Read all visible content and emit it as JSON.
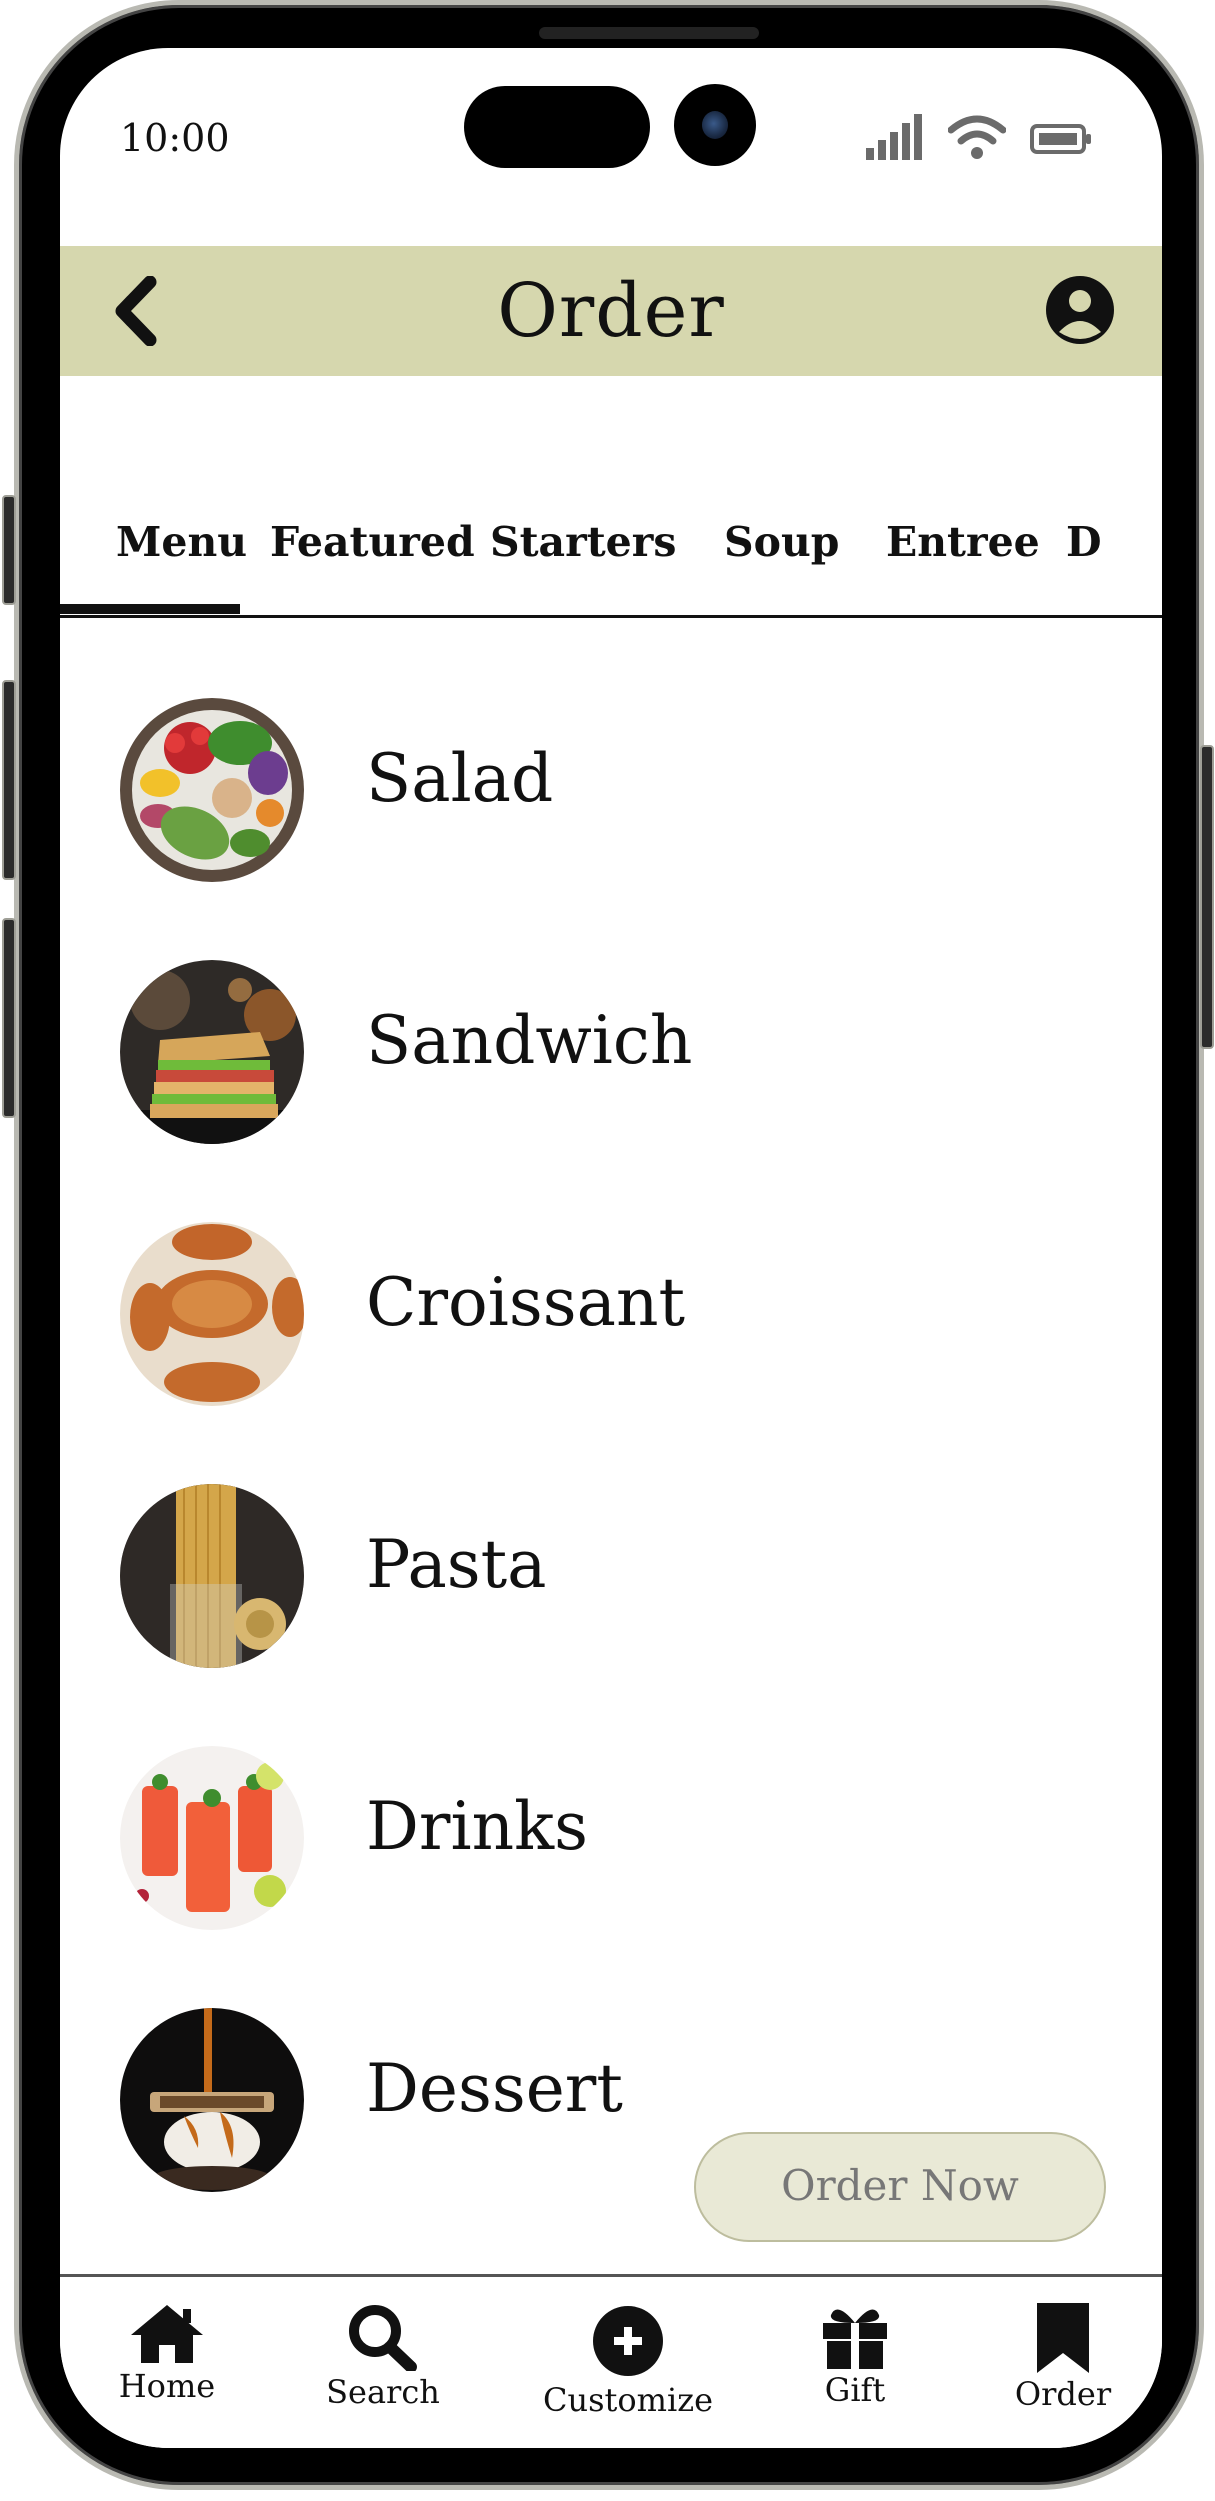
{
  "status_bar": {
    "time": "10:00"
  },
  "header": {
    "title": "Order",
    "back_icon": "chevron-left-icon",
    "profile_icon": "user-circle-icon"
  },
  "tabs": [
    {
      "label": "Menu",
      "active": true
    },
    {
      "label": "Featured"
    },
    {
      "label": "Starters"
    },
    {
      "label": "Soup"
    },
    {
      "label": "Entree"
    },
    {
      "label": "D"
    }
  ],
  "menu_items": [
    {
      "label": "Salad"
    },
    {
      "label": "Sandwich"
    },
    {
      "label": "Croissant"
    },
    {
      "label": "Pasta"
    },
    {
      "label": "Drinks"
    },
    {
      "label": "Dessert"
    }
  ],
  "order_button": {
    "label": "Order Now"
  },
  "bottom_nav": [
    {
      "label": "Home",
      "icon": "home-icon"
    },
    {
      "label": "Search",
      "icon": "search-icon"
    },
    {
      "label": "Customize",
      "icon": "plus-circle-icon"
    },
    {
      "label": "Gift",
      "icon": "gift-icon"
    },
    {
      "label": "Order",
      "icon": "bookmark-icon"
    }
  ],
  "colors": {
    "header_bg": "#d6d7ae",
    "order_button_bg": "#e9e9d6"
  }
}
